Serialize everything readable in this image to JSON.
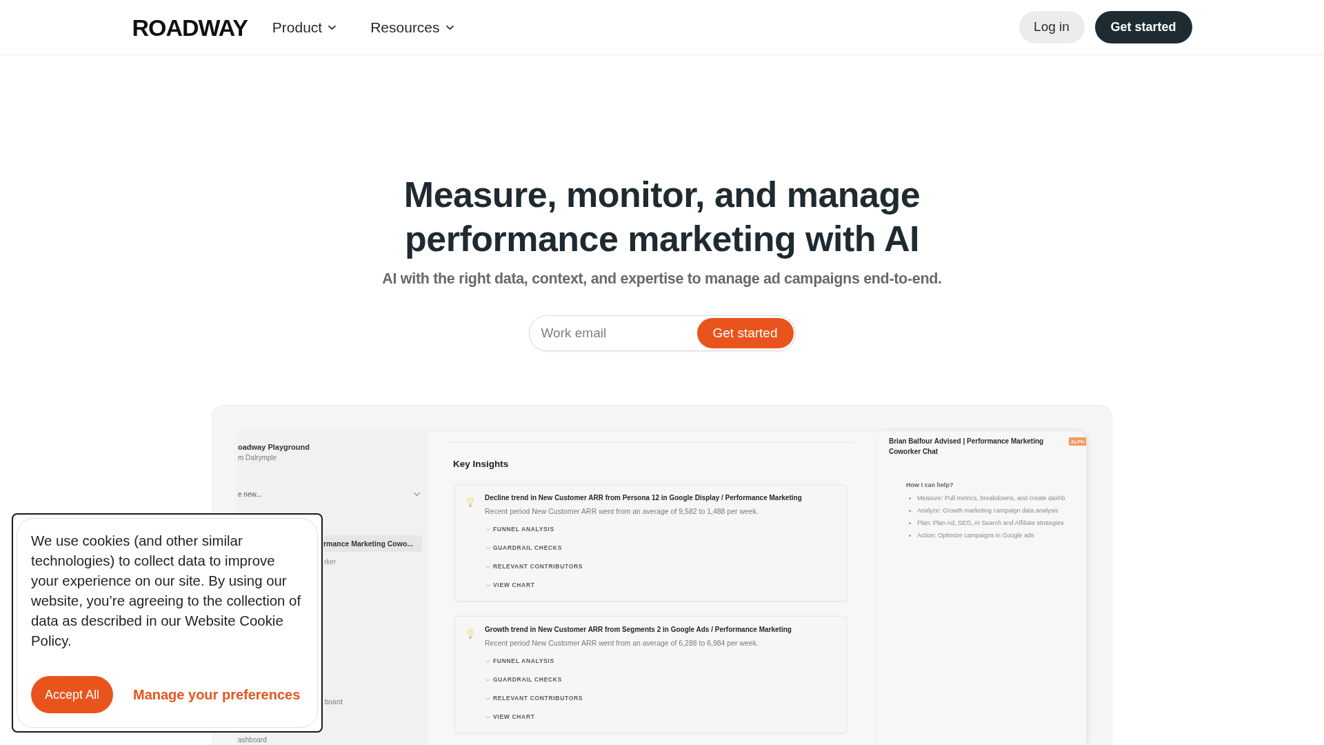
{
  "header": {
    "logo": "ROADWAY",
    "nav": [
      {
        "label": "Product"
      },
      {
        "label": "Resources"
      }
    ],
    "login": "Log in",
    "cta": "Get started"
  },
  "hero": {
    "title": "Measure, monitor, and manage performance marketing with AI",
    "subtitle": "AI with the right data, context, and expertise to manage ad campaigns end-to-end.",
    "email": {
      "placeholder": "Work email"
    },
    "submit": "Get started"
  },
  "preview": {
    "sidebar": {
      "workspace": "oadway Playground",
      "user": "m Dalrymple",
      "new_menu": "e new...",
      "items": [
        {
          "label": "rmance Marketing Cowo...",
          "sublabel": "rker",
          "selected": true
        },
        {
          "label": "board",
          "selected": false
        },
        {
          "label": "ashboard",
          "selected": false
        }
      ]
    },
    "insights": {
      "title": "Key Insights",
      "cards": [
        {
          "title": "Decline trend in New Customer ARR from Persona 12 in Google Display / Performance Marketing",
          "description": "Recent period New Customer ARR went from an average of 9,582 to 1,488 per week.",
          "sections": [
            "FUNNEL ANALYSIS",
            "GUARDRAIL CHECKS",
            "RELEVANT CONTRIBUTORS",
            "VIEW CHART"
          ]
        },
        {
          "title": "Growth trend in New Customer ARR from Segments 2 in Google Ads / Performance Marketing",
          "description": "Recent period New Customer ARR went from an average of 6,288 to 6,984 per week.",
          "sections": [
            "FUNNEL ANALYSIS",
            "GUARDRAIL CHECKS",
            "RELEVANT CONTRIBUTORS",
            "VIEW CHART"
          ]
        }
      ]
    },
    "chat": {
      "title": "Brian Balfour Advised | Performance Marketing Coworker Chat",
      "badge": "ALPH",
      "help_title": "How I can help?",
      "bullets": [
        "Measure: Pull metrics, breakdowns, and create dashb",
        "Analyze: Growth marketing campaign data analysis",
        "Plan: Plan Ad, SEO, AI Search and Affiliate strategies",
        "Action: Optimize campaigns in Google ads"
      ]
    }
  },
  "cookie_banner": {
    "message": "We use cookies (and other similar technologies) to collect data to improve your experience on our site. By using our website, you’re agreeing to the collection of data as described in our Website Cookie Policy.",
    "accept": "Accept All",
    "manage": "Manage your preferences"
  }
}
